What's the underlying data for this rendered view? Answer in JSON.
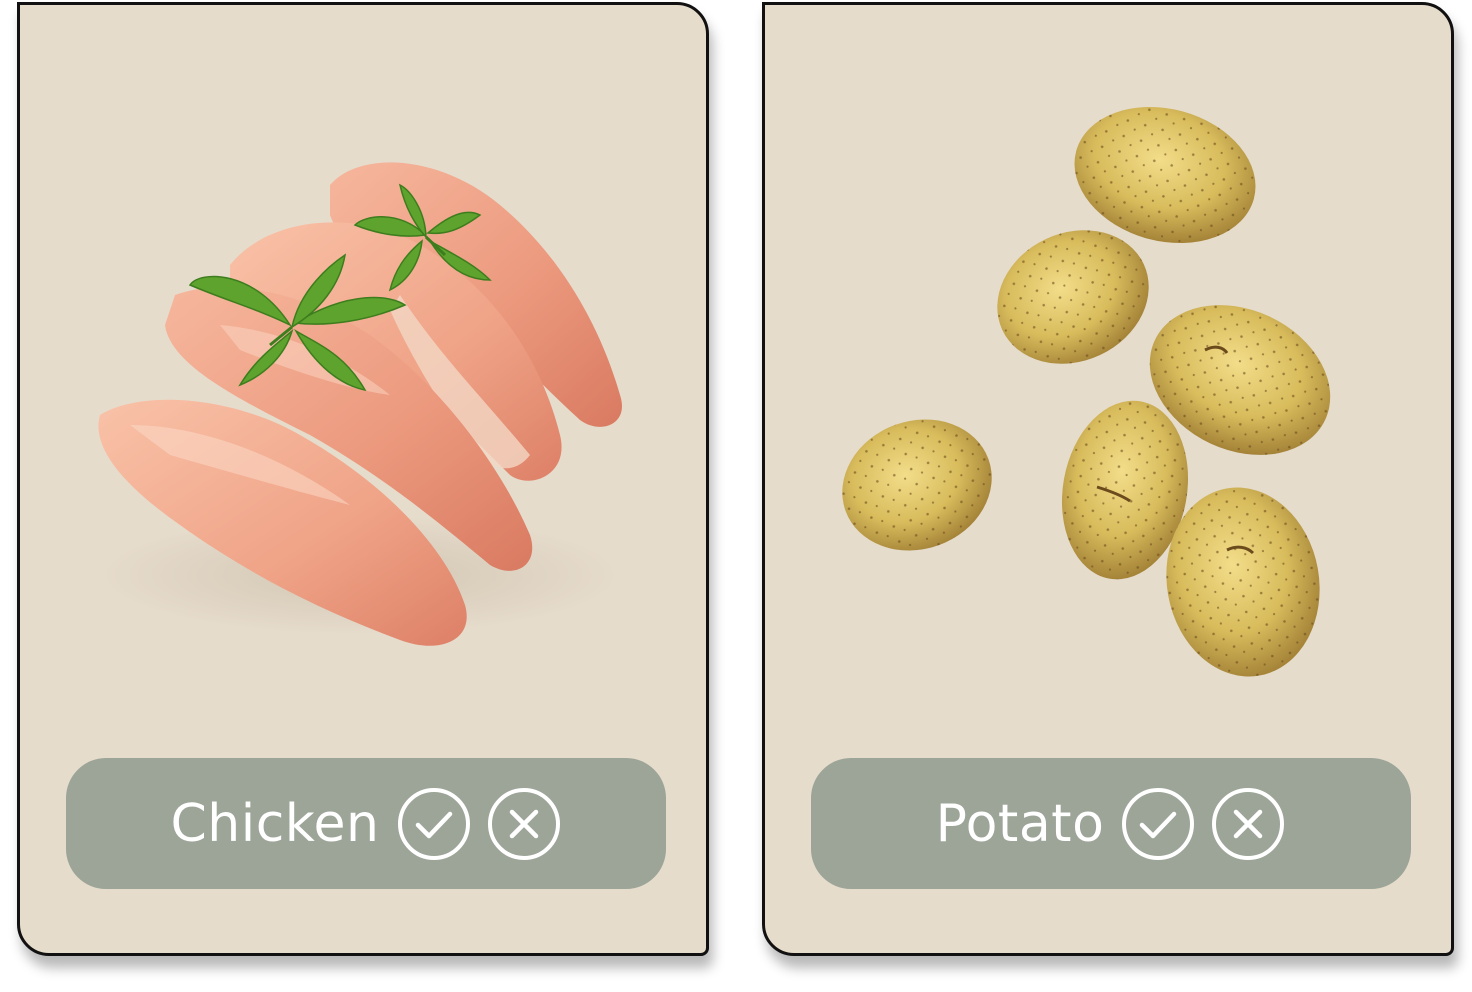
{
  "theme": {
    "card_background": "#e6dccc",
    "label_bar_background": "#9ca598",
    "label_text_color": "#ffffff"
  },
  "cards": [
    {
      "name": "Chicken",
      "image": "raw-chicken-breast-with-basil",
      "actions": {
        "accept_icon": "check-circle-icon",
        "reject_icon": "x-circle-icon"
      }
    },
    {
      "name": "Potato",
      "image": "potatoes",
      "actions": {
        "accept_icon": "check-circle-icon",
        "reject_icon": "x-circle-icon"
      }
    }
  ]
}
